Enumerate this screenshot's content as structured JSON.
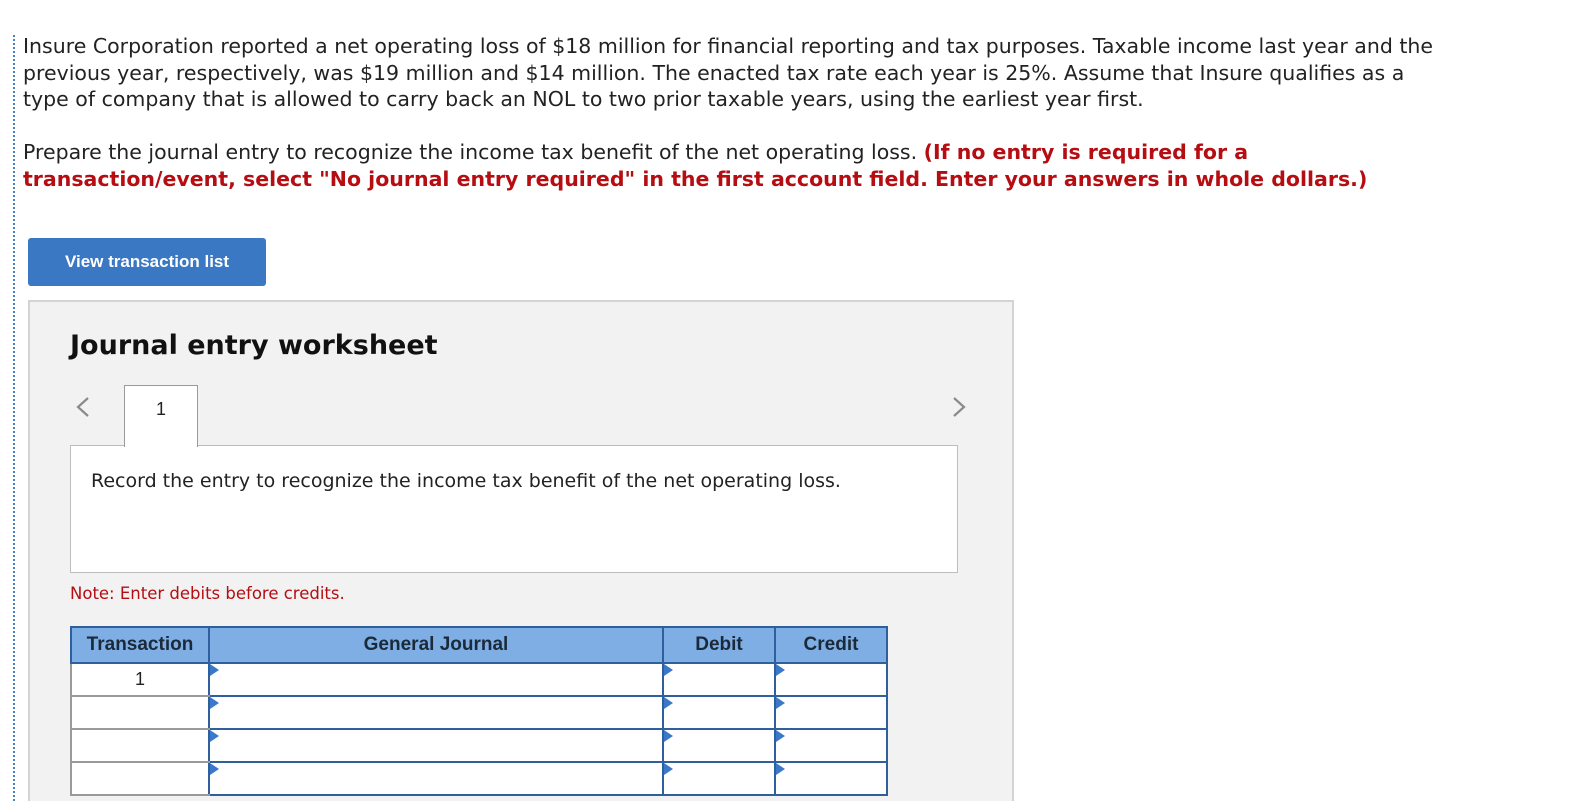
{
  "problem": {
    "text": "Insure Corporation reported a net operating loss of $18 million for financial reporting and tax purposes. Taxable income last year and the previous year, respectively, was $19 million and $14 million. The enacted tax rate each year is 25%. Assume that Insure qualifies as a type of company that is allowed to carry back an NOL to two prior taxable years, using the earliest year first."
  },
  "instructions": {
    "text": "Prepare the journal entry to recognize the income tax benefit of the net operating loss.",
    "highlight": "(If no entry is required for a transaction/event, select \"No journal entry required\" in the first account field. Enter your answers in whole dollars.)"
  },
  "view_transaction_button": "View transaction list",
  "worksheet": {
    "title": "Journal entry worksheet",
    "tabs": [
      "1"
    ],
    "active_tab": "1",
    "record_text": "Record the entry to recognize the income tax benefit of the net operating loss.",
    "note": "Note: Enter debits before credits."
  },
  "journal": {
    "headers": [
      "Transaction",
      "General Journal",
      "Debit",
      "Credit"
    ],
    "rows": [
      {
        "transaction": "1",
        "account": "",
        "debit": "",
        "credit": ""
      },
      {
        "transaction": "",
        "account": "",
        "debit": "",
        "credit": ""
      },
      {
        "transaction": "",
        "account": "",
        "debit": "",
        "credit": ""
      },
      {
        "transaction": "",
        "account": "",
        "debit": "",
        "credit": ""
      }
    ]
  },
  "colors": {
    "button_bg": "#3b78c3",
    "instruction_red": "#b50d12",
    "table_header_bg": "#7eaee4",
    "table_border": "#2f5f9c"
  },
  "icons": {
    "prev": "chevron-left-icon",
    "next": "chevron-right-icon"
  }
}
